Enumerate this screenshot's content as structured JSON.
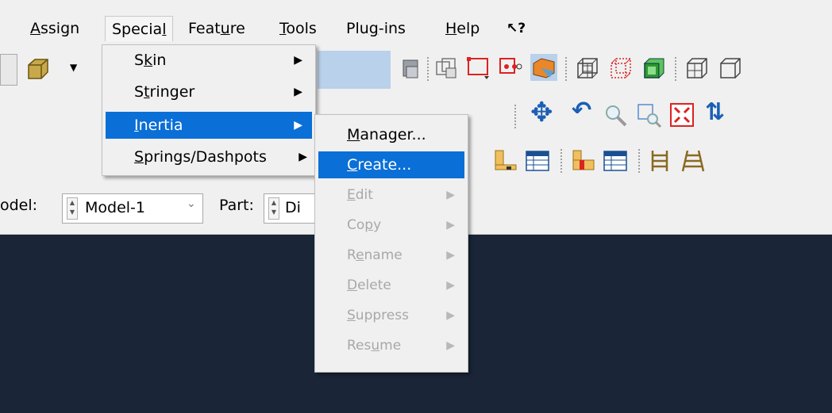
{
  "menubar": {
    "items": [
      {
        "label": "Assign",
        "mnemonic_index": 0
      },
      {
        "label": "Special",
        "mnemonic_index": 6
      },
      {
        "label": "Feature",
        "mnemonic_index": 4
      },
      {
        "label": "Tools",
        "mnemonic_index": 0
      },
      {
        "label": "Plug-ins",
        "mnemonic_index": 3
      },
      {
        "label": "Help",
        "mnemonic_index": 0
      }
    ],
    "whats_this_glyph": "↖?"
  },
  "special_menu": {
    "items": [
      {
        "label": "Skin",
        "mnemonic_index": 1,
        "has_submenu": true,
        "selected": false
      },
      {
        "label": "Stringer",
        "mnemonic_index": 1,
        "has_submenu": true,
        "selected": false
      },
      {
        "label": "Inertia",
        "mnemonic_index": 0,
        "has_submenu": true,
        "selected": true
      },
      {
        "label": "Springs/Dashpots",
        "mnemonic_index": 0,
        "has_submenu": true,
        "selected": false
      }
    ]
  },
  "inertia_submenu": {
    "items": [
      {
        "label": "Manager...",
        "mnemonic_index": 0,
        "enabled": true,
        "selected": false,
        "has_submenu": false
      },
      {
        "label": "Create...",
        "mnemonic_index": 0,
        "enabled": true,
        "selected": true,
        "has_submenu": false
      },
      {
        "label": "Edit",
        "mnemonic_index": 0,
        "enabled": false,
        "selected": false,
        "has_submenu": true
      },
      {
        "label": "Copy",
        "mnemonic_index": 2,
        "enabled": false,
        "selected": false,
        "has_submenu": true
      },
      {
        "label": "Rename",
        "mnemonic_index": 1,
        "enabled": false,
        "selected": false,
        "has_submenu": true
      },
      {
        "label": "Delete",
        "mnemonic_index": 0,
        "enabled": false,
        "selected": false,
        "has_submenu": true
      },
      {
        "label": "Suppress",
        "mnemonic_index": 0,
        "enabled": false,
        "selected": false,
        "has_submenu": true
      },
      {
        "label": "Resume",
        "mnemonic_index": 3,
        "enabled": false,
        "selected": false,
        "has_submenu": true
      }
    ]
  },
  "context_bar": {
    "model_label": "odel:",
    "model_value": "Model-1",
    "part_label": "Part:",
    "part_value": "Di"
  },
  "colors": {
    "selection": "#0a6fd6",
    "viewport_bg": "#1a2638",
    "chrome_bg": "#f0f0f0"
  },
  "icons": [
    "part-cube-icon",
    "query-icon",
    "view-cube-icon",
    "box-zoom-icon",
    "translate-icon",
    "shaded-icon",
    "wireframe-icon",
    "hidden-line-icon",
    "pan-icon",
    "rotate-icon",
    "magnify-icon",
    "zoom-box-icon",
    "fit-view-icon",
    "cycle-view-icon",
    "datum-icon",
    "table-icon",
    "ladder-icon"
  ]
}
